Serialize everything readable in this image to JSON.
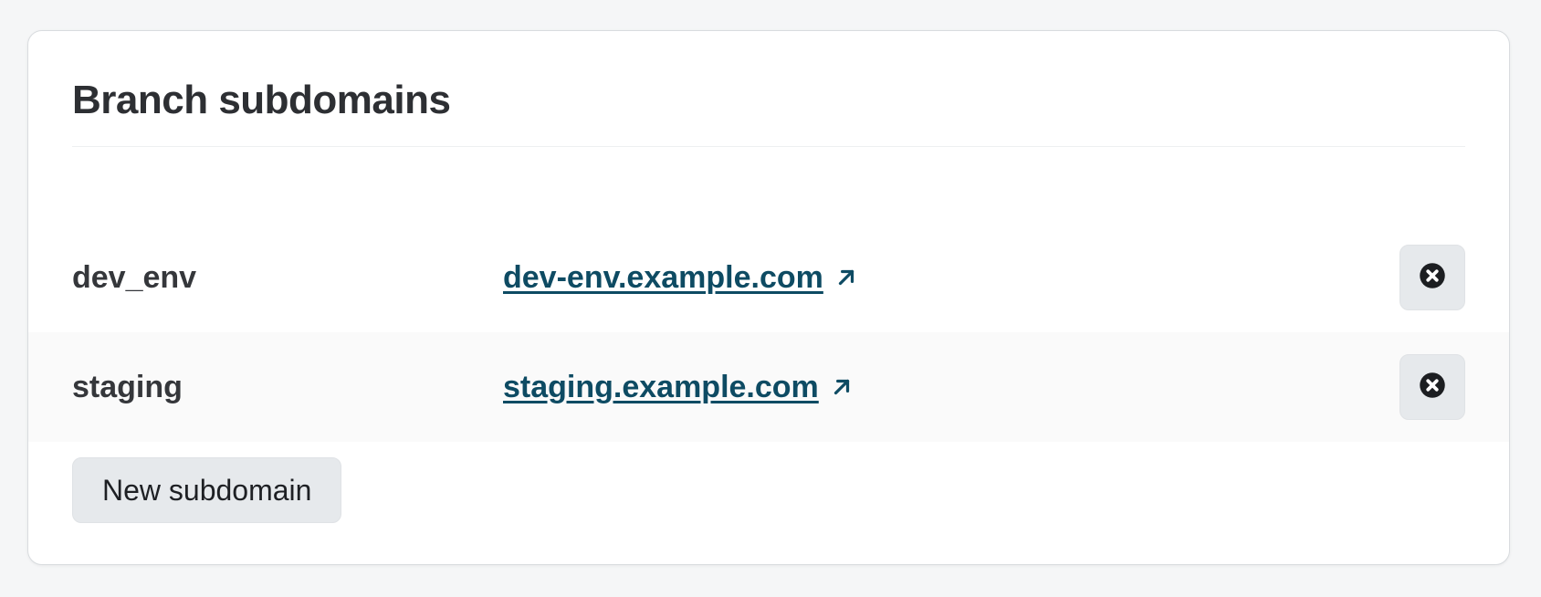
{
  "card": {
    "title": "Branch subdomains"
  },
  "subdomains": [
    {
      "branch": "dev_env",
      "domain": "dev-env.example.com",
      "link_icon": "external-link-icon",
      "delete_icon": "close-circle-icon"
    },
    {
      "branch": "staging",
      "domain": "staging.example.com",
      "link_icon": "external-link-icon",
      "delete_icon": "close-circle-icon"
    }
  ],
  "actions": {
    "new_subdomain_label": "New subdomain"
  },
  "colors": {
    "link": "#0e4b63",
    "button_bg": "#e6e9ec",
    "alt_row_bg": "#fafafa",
    "text": "#2d2f33"
  }
}
